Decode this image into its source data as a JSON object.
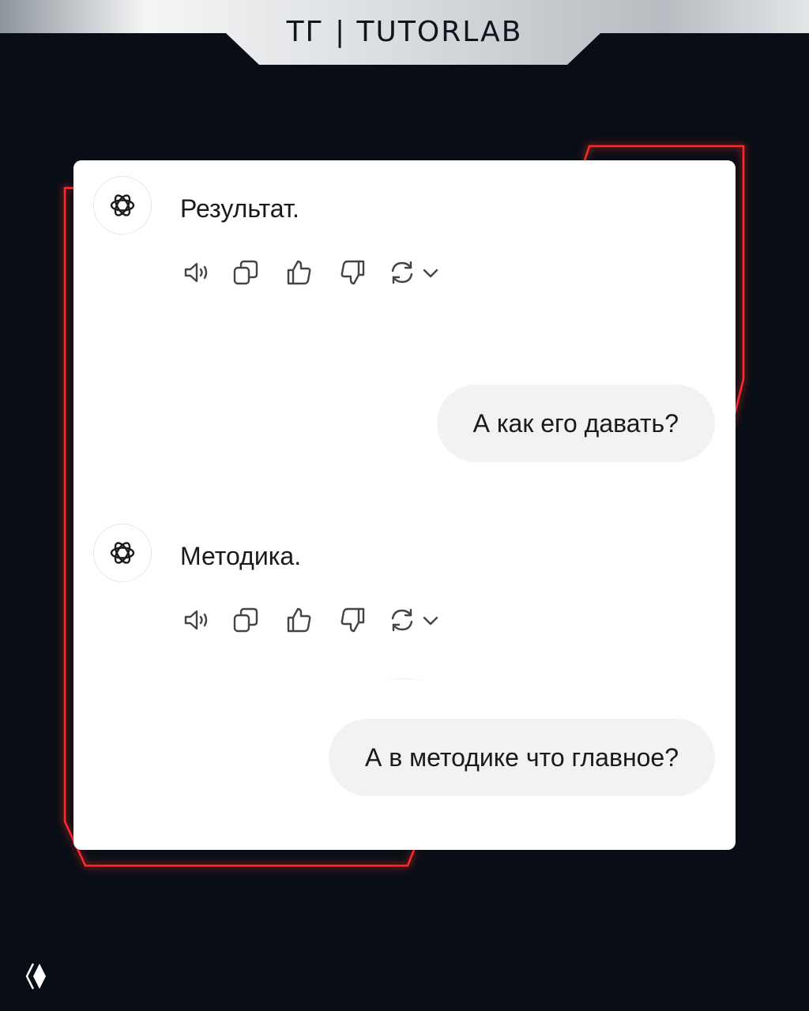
{
  "header": {
    "brand": "ТГ | TUTORLAB"
  },
  "chat": {
    "messages": [
      {
        "role": "assistant",
        "text": "Результат."
      },
      {
        "role": "user",
        "text": "А как его давать?"
      },
      {
        "role": "assistant",
        "text": "Методика."
      },
      {
        "role": "user",
        "text": "А в методике что главное?"
      }
    ],
    "message_actions": [
      "speaker-icon",
      "copy-icon",
      "thumbs-up-icon",
      "thumbs-down-icon",
      "regenerate-icon",
      "chevron-down-icon"
    ]
  },
  "colors": {
    "background": "#090e16",
    "accent_glow": "#ff1f1f",
    "card": "#ffffff",
    "user_bubble": "#f2f2f2"
  }
}
